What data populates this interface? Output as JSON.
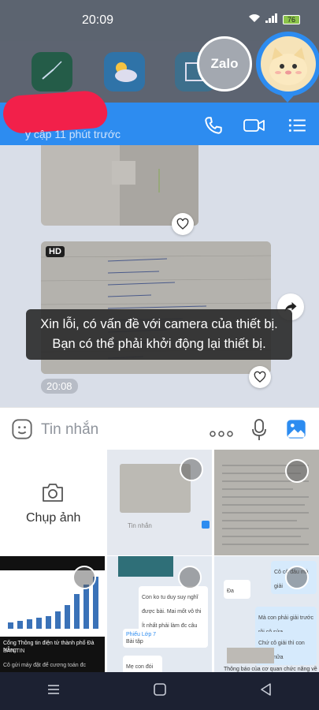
{
  "status": {
    "time": "20:09",
    "battery": "76"
  },
  "bubbles": {
    "zalo_label": "Zalo"
  },
  "header": {
    "subtitle": "y cập 11 phút trước"
  },
  "chat": {
    "hd_badge": "HD",
    "timestamp": "20:08"
  },
  "toast": {
    "message": "Xin lỗi, có vấn đề với camera của thiết bị. Bạn có thể phải khởi động lại thiết bị."
  },
  "input": {
    "placeholder": "Tin nhắn"
  },
  "gallery": {
    "capture_label": "Chụp ảnh",
    "thumb_input_placeholder": "Tin nhắn",
    "chat_thumb": {
      "msg1": "Con ko tu duy suy nghĩ được bài. Mai mốt vô thi ra dạng đề khác thì sao mà biết làm",
      "msg2": "Ít nhất phải làm đc câu a,b",
      "note_title": "Phiếu Lớp 7",
      "note_sub": "Bài tập",
      "msg3": "Mẹ con đói"
    },
    "chat_thumb2": {
      "msg1": "Đa",
      "msg2": "Cô cô đâu mà giải",
      "msg3": "Mà con phải giải trước rồi cô sửa",
      "msg4": "Chứ cô giải thì con nói gì nữa",
      "msg5": "Thông báo của cơ quan chức năng về việc"
    },
    "news_thumb": {
      "caption1": "Cổng Thông tin điện tử thành phố Đà Nẵng",
      "caption2": "BẢN TIN",
      "caption3": "Cô gửi máy đặt để cương toán đc"
    }
  },
  "colors": {
    "accent": "#2d8cf0",
    "toast_bg": "#2d2d2d",
    "nav_bg": "#1c2132"
  }
}
